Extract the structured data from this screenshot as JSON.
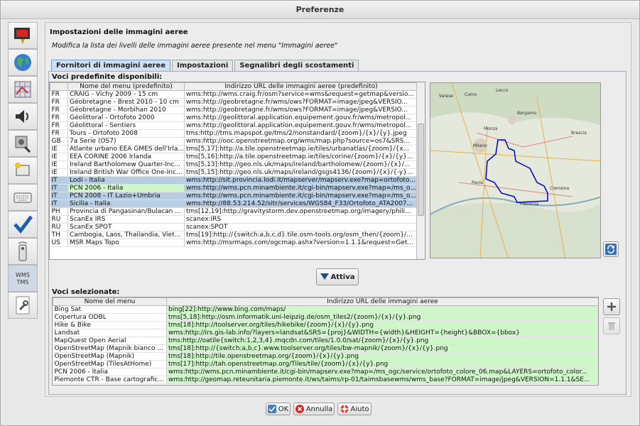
{
  "window": {
    "title": "Preferenze"
  },
  "header": {
    "title": "Impostazioni delle immagini aeree",
    "subtitle": "Modifica la lista dei livelli delle immagini aeree presente nel menu \"Immagini aeree\""
  },
  "tabs": [
    {
      "label": "Fornitori di immagini aeree"
    },
    {
      "label": "Impostazioni"
    },
    {
      "label": "Segnalibri degli scostamenti"
    }
  ],
  "sidebar": {
    "items": [
      {
        "icon": "display-icon"
      },
      {
        "icon": "globe-icon"
      },
      {
        "icon": "grid-icon"
      },
      {
        "icon": "audio-icon"
      },
      {
        "icon": "plugin-icon"
      },
      {
        "icon": "shortcut-icon"
      },
      {
        "icon": "keyboard-icon"
      },
      {
        "icon": "checkmark-icon"
      },
      {
        "icon": "remote-control-icon"
      },
      {
        "icon": "wms-tms-icon",
        "label": "WMS TMS"
      },
      {
        "icon": "advanced-wrench-icon"
      }
    ]
  },
  "defaults": {
    "label": "Voci predefinite disponibili:",
    "columns": [
      "",
      "Nome del menu (predefinito)",
      "Indirizzo URL delle immagini aeree (predefinito)"
    ],
    "rows": [
      [
        "FR",
        "CRAIG - Vichy 2009 - 15 cm",
        "wms:http://wms.craig.fr/osm?service=wms&request=getmap&versio..."
      ],
      [
        "FR",
        "Géobretagne - Brest 2010 - 10 cm",
        "wms:http://geobretagne.fr/wms/ows?FORMAT=image/jpeg&VERSIO..."
      ],
      [
        "FR",
        "Géobretagne - Morbihan 2010",
        "wms:http://geobretagne.fr/wms/ows?FORMAT=image/jpeg&VERSIO..."
      ],
      [
        "FR",
        "Géolittoral - Ortofoto 2000",
        "wms:http://geolittoral.application.equipement.gouv.fr/wms/metropol..."
      ],
      [
        "FR",
        "Géolittoral - Sentiers",
        "wms:http://geolittoral.application.equipement.gouv.fr/wms/metropol..."
      ],
      [
        "FR",
        "Tours - Ortofoto 2008",
        "tms:http://tms.mapspot.ge/tms/2/nonstandard/{zoom}/{x}/{y}.jpeg"
      ],
      [
        "GB",
        "7a Serie (OS7)",
        "wms:http://ooc.openstreetmap.org/wms/map.php?source=os7&SRS..."
      ],
      [
        "IE",
        "Atlante urbano EEA GMES dell'Irla...",
        "tms[5,17]:http://a.tile.openstreetmap.ie/tiles/urbanatlas/{zoom}/{x..."
      ],
      [
        "IE",
        "EEA CORINE 2006 Irlanda",
        "tms[5,16]:http://a.tile.openstreetmap.ie/tiles/corine/{zoom}/{x}/{y}..."
      ],
      [
        "IE",
        "Ireland Bartholomew Quarter-Inc...",
        "tms[5,13]:http://geo.nls.uk/maps/ireland/bartholomew/{zoom}/{x}/..."
      ],
      [
        "IE",
        "Ireland British War Office One-Inc...",
        "tms[5,15]:http://geo.nls.uk/maps/ireland/gsgs4136/{zoom}/{x}/{-y}..."
      ],
      [
        "IT",
        "Lodi - Italia",
        "wms:http://sit.provincia.lodi.it/mapserver/mapserv.exe?map=ortofoto..."
      ],
      [
        "IT",
        "PCN 2006 - Italia",
        "wms:http://wms.pcn.minambiente.it/cgi-bin/mapserv.exe?map=/ms_o..."
      ],
      [
        "IT",
        "PCN 2008 - IT Lazio+Umbria",
        "wms:http://wms.pcn.minambiente.it/cgi-bin/mapserv.exe?map=/ms_o..."
      ],
      [
        "IT",
        "Sicilia - Italia",
        "wms:http://88.53.214.52/sitr/services/WGS84_F33/Ortofoto_ATA2007..."
      ],
      [
        "PH",
        "Provincia di Pangasinan/Bulacan ...",
        "tms[12,19]:http://gravitystorm.dev.openstreetmap.org/imagery/phili..."
      ],
      [
        "RU",
        "ScanEx IRS",
        "scanex:IRS"
      ],
      [
        "RU",
        "ScanEx SPOT",
        "scanex:SPOT"
      ],
      [
        "TH",
        "Cambogia, Laos, Thailandia, Viet...",
        "tms[19]:http://{switch:a,b,c,d}.tile.osm-tools.org/osm_then/{zoom}/..."
      ],
      [
        "US",
        "MSR Maps Topo",
        "wms:http://msrmaps.com/ogcmap.ashx?version=1.1.1&request=Get..."
      ]
    ],
    "selected_rows": [
      11,
      12,
      13,
      14
    ],
    "green_rows": [
      12
    ]
  },
  "map": {
    "labels": [
      "Varese",
      "Como",
      "Lecco",
      "Bergamo",
      "Monza",
      "Milano",
      "Brescia",
      "Pavia",
      "Cremona",
      "Piacenza"
    ]
  },
  "activate_button": {
    "label": "Attiva"
  },
  "selected": {
    "label": "Voci selezionate:",
    "columns": [
      "Nome del menu",
      "Indirizzo URL delle immagini aeree"
    ],
    "rows": [
      [
        "Bing Sat",
        "bing[22]:http://www.bing.com/maps/"
      ],
      [
        "Copertura ODBL",
        "tms[5,18]:http://osm.informatik.uni-leipzig.de/osm_tiles2/{zoom}/{x}/{y}.png"
      ],
      [
        "Hike & Bike",
        "tms[18]:http://toolserver.org/tiles/hikebike/{zoom}/{x}/{y}.png"
      ],
      [
        "Landsat",
        "wms:http://irs.gis-lab.info/?layers=landsat&SRS={proj}&WIDTH={width}&HEIGHT={height}&BBOX={bbox}"
      ],
      [
        "MapQuest Open Aerial",
        "tms:http://oatile{switch:1,2,3,4}.mqcdn.com/tiles/1.0.0/sat/{zoom}/{x}/{y}.png"
      ],
      [
        "OpenStreetMap (Mapnik bianco ...",
        "tms[18]:http://{switch:a,b,c}.www.toolserver.org/tiles/bw-mapnik/{zoom}/{x}/{y}.png"
      ],
      [
        "OpenStreetMap (Mapnik)",
        "tms[18]:http://tile.openstreetmap.org/{zoom}/{x}/{y}.png"
      ],
      [
        "OpenStreetMap (TilesAtHome)",
        "tms[17]:http://tah.openstreetmap.org/Tiles/tile/{zoom}/{x}/{y}.png"
      ],
      [
        "PCN 2006 - Italia",
        "wms:http://wms.pcn.minambiente.it/cgi-bin/mapserv.exe?map=/ms_ogc/service/ortofoto_colore_06.map&LAYERS=ortofoto_color..."
      ],
      [
        "Piemonte CTR - Base cartografic...",
        "wms:http://geomap.reteunitaria.piemonte.it/ws/taims/rp-01/taimsbasewms/wms_base?FORMAT=image/jpeg&VERSION=1.1.1&SE..."
      ]
    ]
  },
  "buttons": {
    "ok": "OK",
    "cancel": "Annulla",
    "help": "Aiuto"
  }
}
